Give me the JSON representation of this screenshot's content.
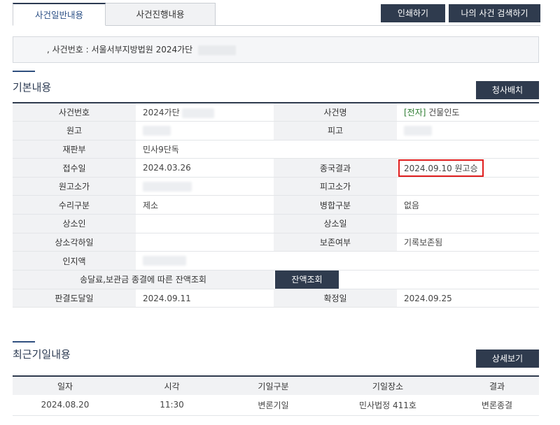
{
  "tabs": {
    "general": "사건일반내용",
    "progress": "사건진행내용"
  },
  "buttons": {
    "print": "인쇄하기",
    "my_case_search": "나의 사건 검색하기",
    "send_fee": "청사배치",
    "balance": "잔액조회",
    "detail": "상세보기"
  },
  "notice": {
    "text": ", 사건번호 : 서울서부지방법원 2024가단"
  },
  "basic": {
    "title": "기본내용",
    "labels": {
      "case_no": "사건번호",
      "case_name": "사건명",
      "plaintiff": "원고",
      "defendant": "피고",
      "court_dept": "재판부",
      "receipt_date": "접수일",
      "final_result": "종국결과",
      "plaintiff_amount": "원고소가",
      "defendant_amount": "피고소가",
      "receipt_type": "수리구분",
      "merge_type": "병합구분",
      "appellant": "상소인",
      "appeal_date": "상소일",
      "appeal_dismiss_date": "상소각하일",
      "preserve": "보존여부",
      "stamp_amount": "인지액",
      "fee_inquiry": "송달료,보관금 종결에 따른 잔액조회",
      "ruling_delivery": "판결도달일",
      "confirm_date": "확정일"
    },
    "values": {
      "case_no": "2024가단",
      "case_name_tag": "[전자]",
      "case_name": " 건물인도",
      "court_dept": "민사9단독",
      "receipt_date": "2024.03.26",
      "final_result": "2024.09.10 원고승",
      "receipt_type": "제소",
      "merge_type": "없음",
      "preserve": "기록보존됨",
      "ruling_delivery": "2024.09.11",
      "confirm_date": "2024.09.25"
    }
  },
  "recent": {
    "title": "최근기일내용",
    "headers": [
      "일자",
      "시각",
      "기일구분",
      "기일장소",
      "결과"
    ],
    "rows": [
      [
        "2024.08.20",
        "11:30",
        "변론기일",
        "민사법정 411호",
        "변론종결"
      ]
    ]
  },
  "colors": {
    "dark_button": "#2f3b4e",
    "highlight": "#e01e1e",
    "tag_green": "#2e7d32"
  }
}
